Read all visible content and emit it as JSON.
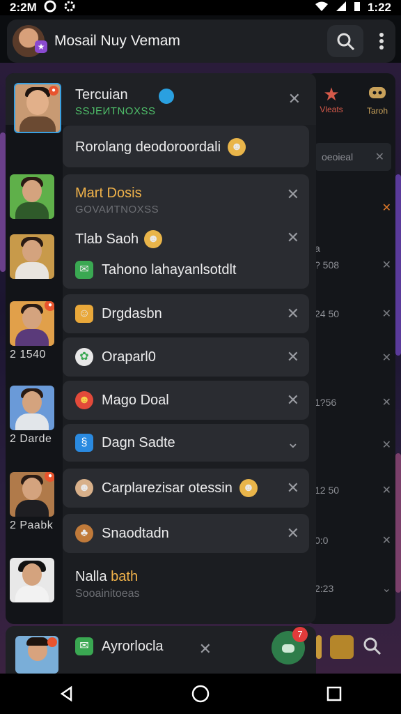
{
  "status_bar": {
    "time_left": "2:2M",
    "time_right": "1:22",
    "left_icons": [
      "record-icon",
      "settings-icon"
    ],
    "right_icons": [
      "wifi-icon",
      "signal-icon",
      "battery-icon"
    ]
  },
  "app_bar": {
    "title": "Mosail Nuy Vemam",
    "avatar_badge": "★"
  },
  "background_panel": {
    "tabs": [
      {
        "label": "Vleats",
        "icon": "star-icon"
      },
      {
        "label": "Taroh",
        "icon": "game-icon"
      }
    ],
    "rows": [
      {
        "text": "oeoieal",
        "value": ""
      },
      {
        "text": "a",
        "value": ""
      },
      {
        "text": "a",
        "value": "? 508"
      },
      {
        "text": "",
        "value": "24 50"
      },
      {
        "text": "",
        "value": "1?56"
      },
      {
        "text": "",
        "value": "12 50"
      },
      {
        "text": "",
        "value": "0:0"
      },
      {
        "text": "",
        "value": "2:23"
      }
    ]
  },
  "notifications": [
    {
      "name": "Tercuian",
      "sub": "SSJEИTNOXSS",
      "message": "Rorolang deodoroordali"
    },
    {
      "name": "Mart Dosis",
      "sub": "GOVAИTNOXSS"
    },
    {
      "name": "Tlab Saoh"
    },
    {
      "name": "Tahono lahayanlsotdlt"
    },
    {
      "name": "Drgdasbn"
    },
    {
      "name": "Oraparl0"
    },
    {
      "name": "Mago Doal"
    },
    {
      "name": "Dagn Sadte"
    },
    {
      "name": "Carplarezisar otessin"
    },
    {
      "name": "Snaodtadn"
    },
    {
      "name": "Nalla",
      "name_accent": "bath",
      "sub": "Sooainitoeas"
    }
  ],
  "contacts": [
    {
      "label": ""
    },
    {
      "label": ""
    },
    {
      "label": "2 1540"
    },
    {
      "label": "2 Darde"
    },
    {
      "label": "2 Paabk"
    },
    {
      "label": ""
    }
  ],
  "bottom_card": {
    "name": "Ayrorlocla",
    "badge_count": "7"
  }
}
